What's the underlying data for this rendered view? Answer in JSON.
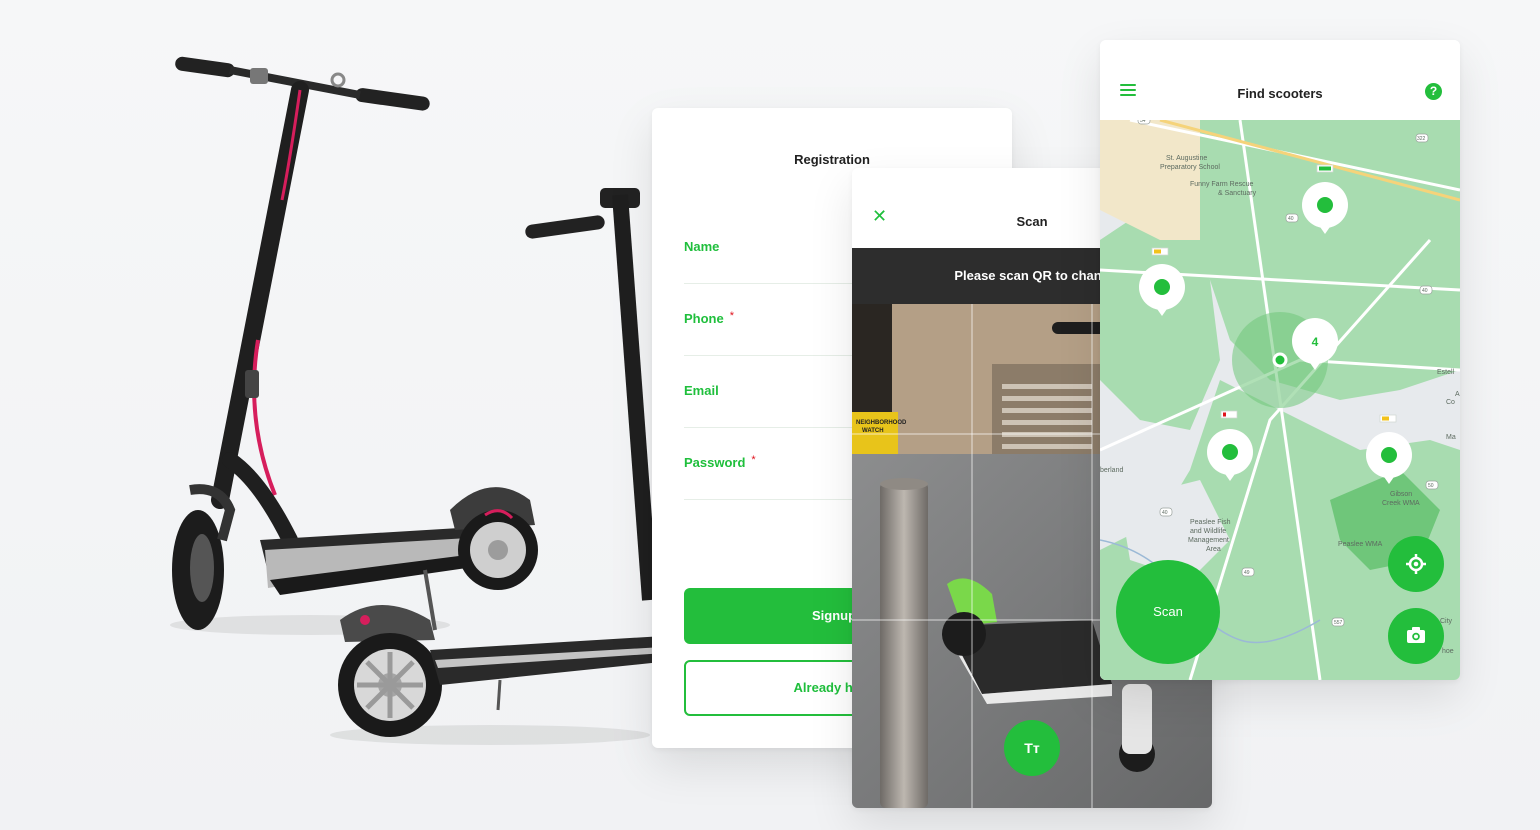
{
  "registration": {
    "title": "Registration",
    "fields": [
      {
        "label": "Name",
        "required": false
      },
      {
        "label": "Phone",
        "required": true
      },
      {
        "label": "Email",
        "required": false
      },
      {
        "label": "Password",
        "required": true
      }
    ],
    "required_mark": "*",
    "signup_label": "Signup",
    "login_label": "Already have"
  },
  "scan": {
    "title": "Scan",
    "close_icon": "close-icon",
    "instruction": "Please scan QR to chang",
    "text_toggle_label": "Tт",
    "sticker_text": [
      "NEIGHBORHOOD",
      "WATCH"
    ]
  },
  "find": {
    "title": "Find scooters",
    "menu_icon": "hamburger-menu-icon",
    "help_icon": "question-circle-icon",
    "help_glyph": "?",
    "scan_label": "Scan",
    "cluster_count": "4",
    "locate_icon": "crosshair-icon",
    "camera_icon": "camera-icon",
    "map_labels": {
      "school": "St. Augustine",
      "school2": "Preparatory School",
      "farm": "Funny Farm Rescue",
      "farm2": "& Sanctuary",
      "gibson": "Gibson",
      "gibson2": "Creek WMA",
      "peaslee": "Peaslee Fish",
      "peaslee2": "and Wildlife",
      "peaslee3": "Management",
      "peaslee4": "Area",
      "peaslee_wma": "Peaslee WMA",
      "estell": "Estell",
      "cumberland": "berland",
      "city": "City",
      "shoe": "hoe",
      "a": "A",
      "co": "Co",
      "ma": "Ma",
      "r54": "54",
      "r40": "40",
      "r49": "49",
      "r50": "50",
      "r557": "557",
      "r322": "322"
    },
    "colors": {
      "accent": "#23be3c",
      "map_green": "#a8dcb0",
      "map_gray": "#e7eaed",
      "battery_full": "#23be3c",
      "battery_mid": "#f2c21b",
      "battery_low": "#e0121c"
    }
  }
}
